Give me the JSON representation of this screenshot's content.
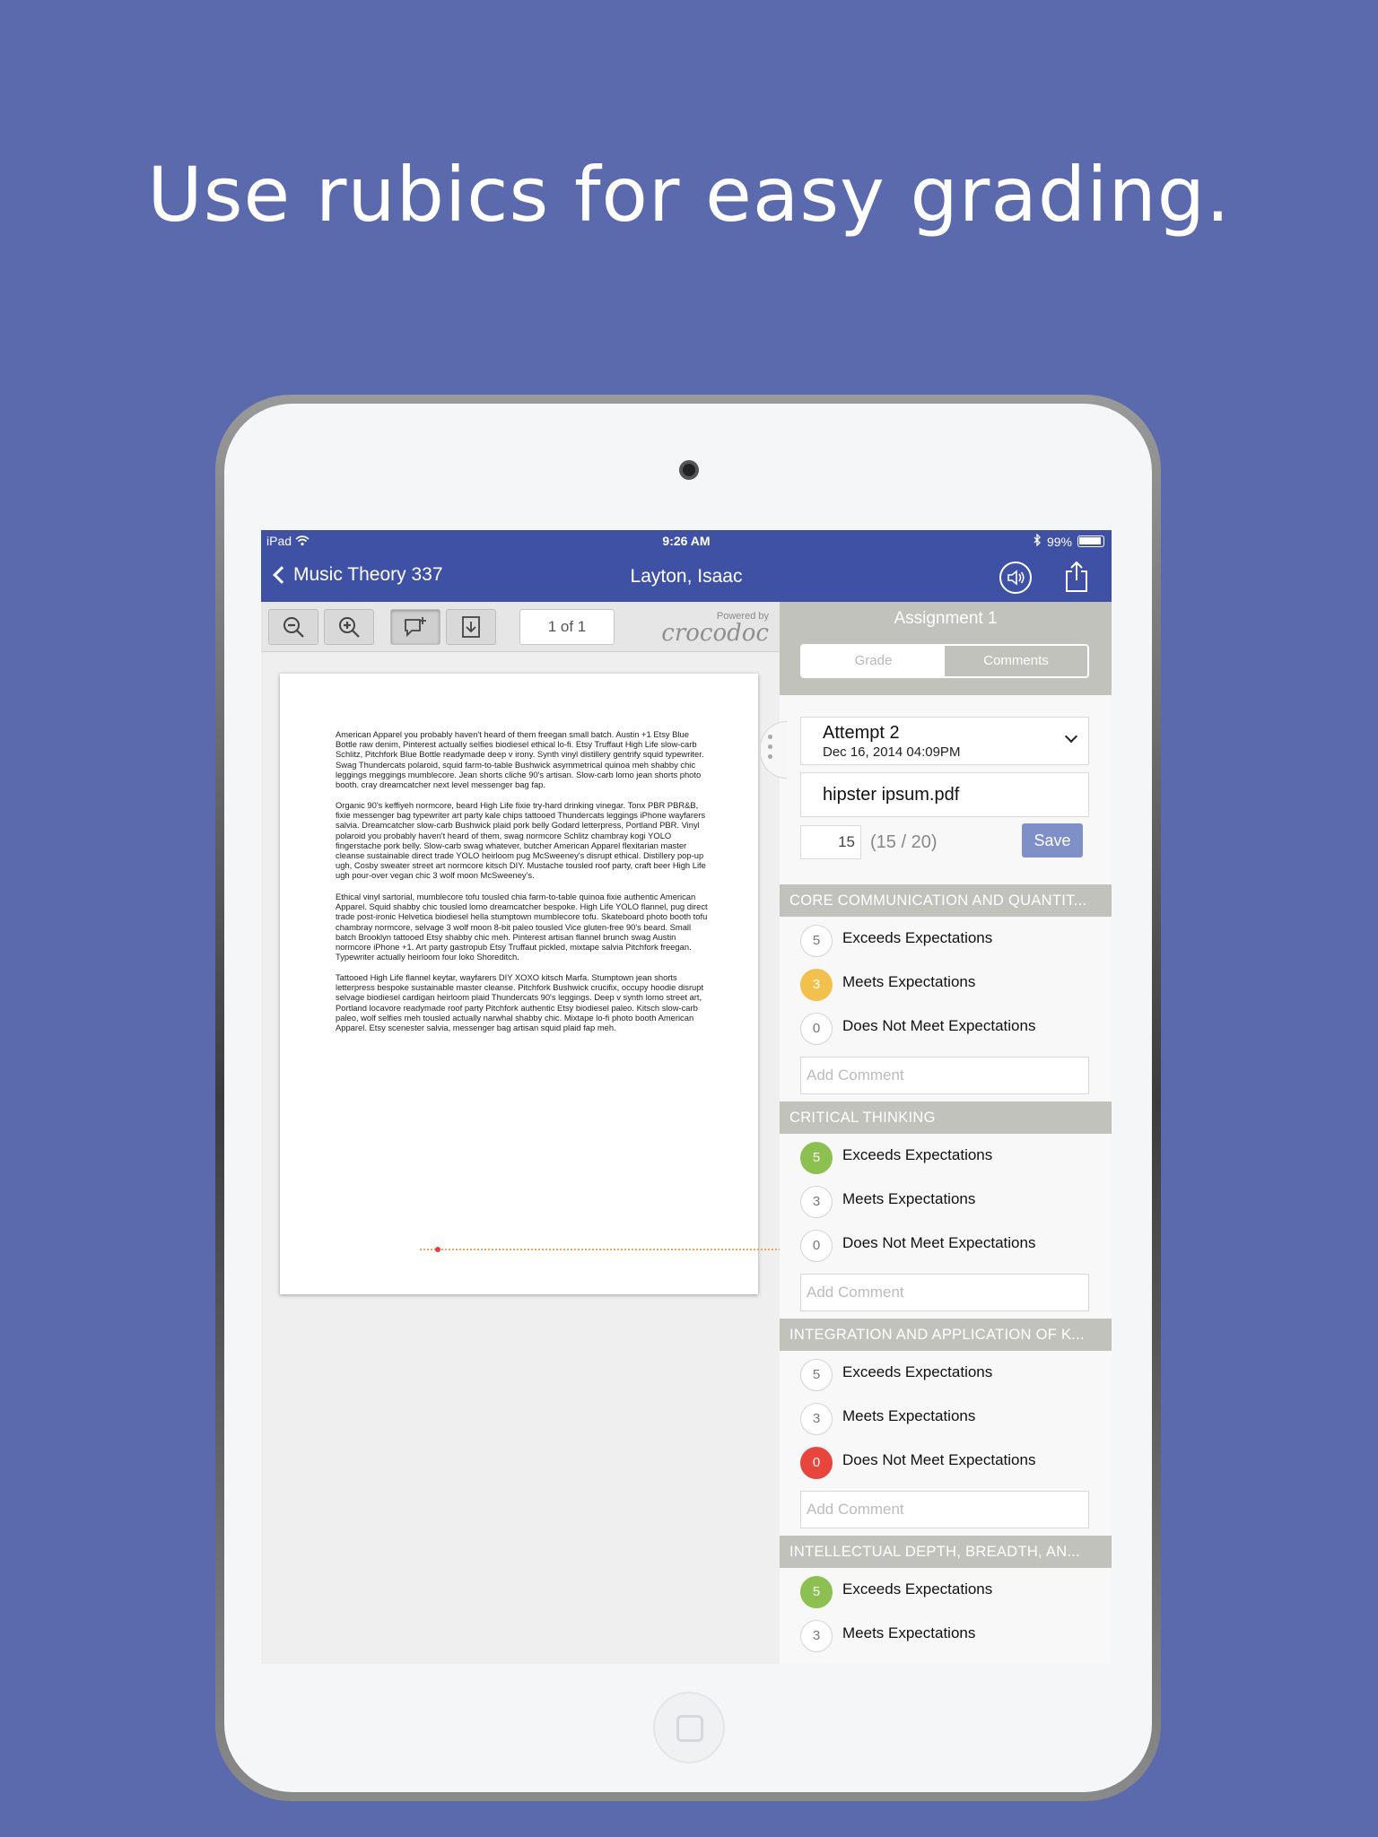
{
  "headline": "Use rubics for easy grading.",
  "status_bar": {
    "device": "iPad",
    "time": "9:26 AM",
    "battery": "99%"
  },
  "nav": {
    "back_label": "Music Theory 337",
    "title": "Layton, Isaac"
  },
  "doc_toolbar": {
    "page_indicator": "1 of 1",
    "powered_by": "Powered by",
    "brand": "crocodoc"
  },
  "document": {
    "paragraphs": [
      "American Apparel you probably haven't heard of them freegan small batch. Austin +1 Etsy Blue Bottle raw denim, Pinterest actually selfies biodiesel ethical lo-fi. Etsy Truffaut High Life slow-carb Schlitz, Pitchfork Blue Bottle readymade deep v irony. Synth vinyl distillery gentrify squid typewriter. Swag Thundercats polaroid, squid farm-to-table Bushwick asymmetrical quinoa meh shabby chic leggings meggings mumblecore. Jean shorts cliche 90's artisan. Slow-carb lomo jean shorts photo booth. cray dreamcatcher next level messenger bag fap.",
      "Organic 90's keffiyeh normcore, beard High Life fixie try-hard drinking vinegar. Tonx PBR PBR&B, fixie messenger bag typewriter art party kale chips tattooed Thundercats leggings iPhone wayfarers salvia. Dreamcatcher slow-carb Bushwick plaid pork belly Godard letterpress, Portland PBR. Vinyl polaroid you probably haven't heard of them, swag normcore Schlitz chambray kogi YOLO fingerstache pork belly. Slow-carb swag whatever, butcher American Apparel flexitarian master cleanse sustainable direct trade YOLO heirloom pug McSweeney's disrupt ethical. Distillery pop-up ugh, Cosby sweater street art normcore kitsch DIY. Mustache tousled roof party, craft beer High Life ugh pour-over vegan chic 3 wolf moon McSweeney's.",
      "Ethical vinyl sartorial, mumblecore tofu tousled chia farm-to-table quinoa fixie authentic American Apparel. Squid shabby chic tousled lomo dreamcatcher bespoke. High Life YOLO flannel, pug direct trade post-ironic Helvetica biodiesel hella stumptown mumblecore tofu. Skateboard photo booth tofu chambray normcore, selvage 3 wolf moon 8-bit paleo tousled Vice gluten-free 90's beard. Small batch Brooklyn tattooed Etsy shabby chic meh. Pinterest artisan flannel brunch swag Austin normcore iPhone +1. Art party gastropub Etsy Truffaut pickled, mixtape salvia Pitchfork freegan. Typewriter actually heirloom four loko Shoreditch.",
      "Tattooed High Life flannel keytar, wayfarers DIY XOXO kitsch Marfa. Stumptown jean shorts letterpress bespoke sustainable master cleanse. Pitchfork Bushwick crucifix, occupy hoodie disrupt selvage biodiesel cardigan heirloom plaid Thundercats 90's leggings. Deep v synth lomo street art, Portland locavore readymade roof party Pitchfork authentic Etsy biodiesel paleo. Kitsch slow-carb paleo, wolf selfies meh tousled actually narwhal shabby chic. Mixtape lo-fi photo booth American Apparel. Etsy scenester salvia, messenger bag artisan squid plaid fap meh."
    ]
  },
  "grading": {
    "assignment_title": "Assignment 1",
    "tabs": [
      "Grade",
      "Comments"
    ],
    "attempt_label": "Attempt 2",
    "attempt_date": "Dec 16, 2014 04:09PM",
    "file_name": "hipster ipsum.pdf",
    "score_value": "15",
    "score_total": "(15 / 20)",
    "save_label": "Save",
    "add_comment_placeholder": "Add Comment",
    "rubrics": [
      {
        "title": "CORE COMMUNICATION AND QUANTIT...",
        "options": [
          {
            "points": "5",
            "label": "Exceeds Expectations",
            "state": "none"
          },
          {
            "points": "3",
            "label": "Meets Expectations",
            "state": "yellow"
          },
          {
            "points": "0",
            "label": "Does Not Meet Expectations",
            "state": "none"
          }
        ]
      },
      {
        "title": "CRITICAL THINKING",
        "options": [
          {
            "points": "5",
            "label": "Exceeds Expectations",
            "state": "green"
          },
          {
            "points": "3",
            "label": "Meets Expectations",
            "state": "none"
          },
          {
            "points": "0",
            "label": "Does Not Meet Expectations",
            "state": "none"
          }
        ]
      },
      {
        "title": "INTEGRATION AND APPLICATION OF K...",
        "options": [
          {
            "points": "5",
            "label": "Exceeds Expectations",
            "state": "none"
          },
          {
            "points": "3",
            "label": "Meets Expectations",
            "state": "none"
          },
          {
            "points": "0",
            "label": "Does Not Meet Expectations",
            "state": "red"
          }
        ]
      },
      {
        "title": "INTELLECTUAL DEPTH, BREADTH, AN...",
        "options": [
          {
            "points": "5",
            "label": "Exceeds Expectations",
            "state": "green"
          },
          {
            "points": "3",
            "label": "Meets Expectations",
            "state": "none"
          }
        ]
      }
    ]
  },
  "colors": {
    "background": "#5b6aad",
    "navbar": "#3f51a5",
    "rubric_header": "#c2c2bd",
    "save_button": "#7f8fc8",
    "selected_yellow": "#f2c04c",
    "selected_green": "#8cc152",
    "selected_red": "#e8453c"
  },
  "icons": [
    "wifi-icon",
    "bluetooth-icon",
    "battery-icon",
    "back-chevron-icon",
    "speaker-icon",
    "share-icon",
    "zoom-out-icon",
    "zoom-in-icon",
    "add-comment-icon",
    "download-icon",
    "dropdown-chevron-icon"
  ]
}
